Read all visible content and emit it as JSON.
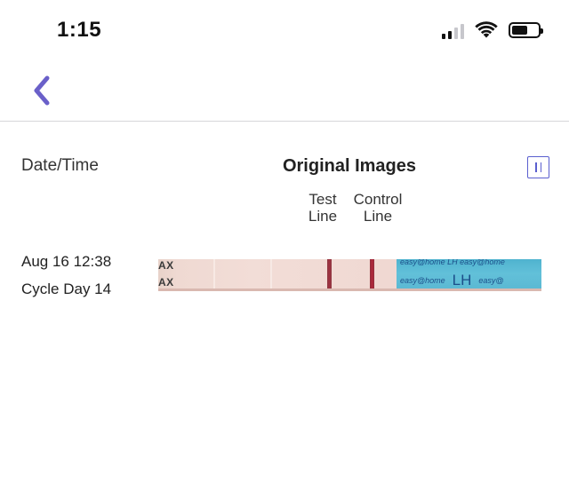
{
  "status_bar": {
    "time": "1:15",
    "signal_icon": "cellular-signal-icon",
    "wifi_icon": "wifi-icon",
    "battery_icon": "battery-icon"
  },
  "nav": {
    "back_icon": "chevron-left-icon",
    "accent_color": "#6a60c9"
  },
  "table": {
    "date_header": "Date/Time",
    "images_header": "Original Images",
    "pause_icon": "pause-icon",
    "test_line_label": "Test Line",
    "control_line_label": "Control Line"
  },
  "entries": [
    {
      "date_time": "Aug 16 12:38",
      "cycle_day": "Cycle Day 14",
      "strip": {
        "left_text_top": "AX",
        "left_text_bottom": "AX",
        "brand_top": "easy@home LH easy@home",
        "brand_bottom_left": "easy@home",
        "brand_label": "LH",
        "brand_bottom_right": "easy@"
      }
    }
  ]
}
